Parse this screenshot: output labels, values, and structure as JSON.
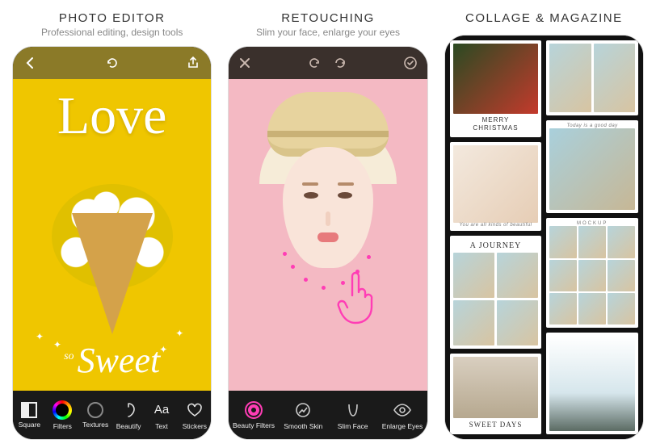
{
  "slots": [
    {
      "title": "PHOTO EDITOR",
      "subtitle": "Professional editing, design tools"
    },
    {
      "title": "RETOUCHING",
      "subtitle": "Slim your face, enlarge your eyes"
    },
    {
      "title": "COLLAGE & MAGAZINE",
      "subtitle": ""
    }
  ],
  "editor": {
    "art_top": "Love",
    "art_bottom_prefix": "so",
    "art_bottom": "Sweet",
    "tools": [
      {
        "label": "Square"
      },
      {
        "label": "Filters"
      },
      {
        "label": "Textures"
      },
      {
        "label": "Beautify"
      },
      {
        "label": "Text"
      },
      {
        "label": "Stickers"
      }
    ]
  },
  "retouch": {
    "tools": [
      {
        "label": "Beauty Filters"
      },
      {
        "label": "Smooth Skin"
      },
      {
        "label": "Slim Face"
      },
      {
        "label": "Enlarge Eyes"
      }
    ]
  },
  "collage": {
    "cards": {
      "merry": "MERRY",
      "christmas": "CHRISTMAS",
      "beautiful": "You are all kinds of beautiful",
      "journey": "A JOURNEY",
      "sweet_days": "SWEET DAYS",
      "good_day": "Today is a good day",
      "mockup": "MOCKUP"
    }
  }
}
